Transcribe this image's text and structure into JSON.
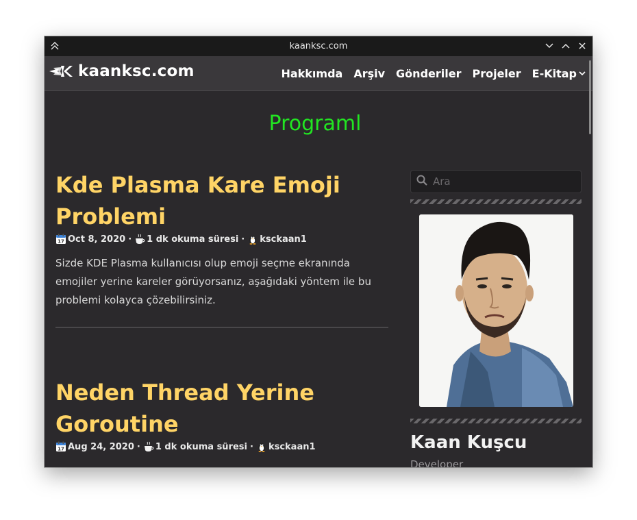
{
  "window": {
    "title": "kaanksc.com"
  },
  "nav": {
    "brand": "kaanksc.com",
    "links": [
      "Hakkımda",
      "Arşiv",
      "Gönderiler",
      "Projeler",
      "E-Kitap"
    ]
  },
  "page": {
    "heading": "Programl"
  },
  "posts": [
    {
      "title_lines": [
        "Kde Plasma Kare Emoji",
        "Problemi"
      ],
      "date": "Oct 8, 2020",
      "reading_time": "1 dk okuma süresi",
      "author": "ksckaan1",
      "excerpt": "Sizde KDE Plasma kullanıcısı olup emoji seçme ekranında emojiler yerine kareler görüyorsanız, aşağıdaki yöntem ile bu problemi kolayca çözebilirsiniz."
    },
    {
      "title_lines": [
        "Neden Thread Yerine",
        "Goroutine"
      ],
      "date": "Aug 24, 2020",
      "reading_time": "1 dk okuma süresi",
      "author": "ksckaan1"
    }
  ],
  "sidebar": {
    "search_placeholder": "Ara",
    "author_name": "Kaan Kuşcu",
    "author_role": "Developer"
  },
  "meta_separator": "·",
  "icons": {
    "window": [
      "keep-above-icon",
      "minimize-icon",
      "maximize-icon",
      "close-icon"
    ],
    "nav": [
      "brand-logo-icon",
      "chevron-down-icon"
    ],
    "post_meta": [
      "calendar-icon",
      "coffee-icon",
      "penguin-icon"
    ],
    "sidebar": [
      "search-icon"
    ]
  },
  "colors": {
    "background": "#2b292c",
    "navbar": "#3a383b",
    "titlebar": "#1a1a1a",
    "heading_green": "#22e622",
    "post_title_yellow": "#ffd466"
  }
}
